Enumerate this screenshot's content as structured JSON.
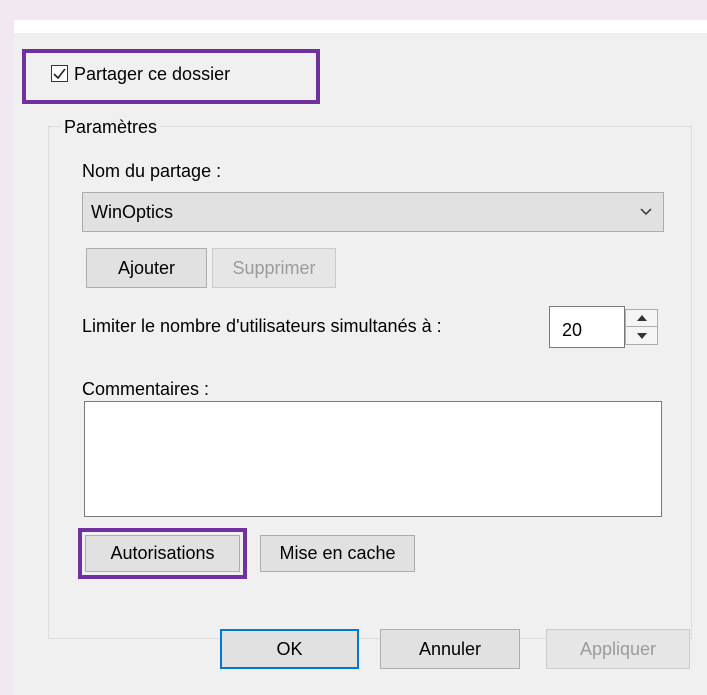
{
  "share": {
    "checkbox_label": "Partager ce dossier",
    "checked": true
  },
  "params": {
    "legend": "Paramètres",
    "share_name_label": "Nom du partage :",
    "share_name_value": "WinOptics",
    "add_button": "Ajouter",
    "remove_button": "Supprimer",
    "limit_label": "Limiter le nombre d'utilisateurs simultanés à :",
    "limit_value": "20",
    "comments_label": "Commentaires :",
    "comments_value": "",
    "permissions_button": "Autorisations",
    "caching_button": "Mise en cache"
  },
  "footer": {
    "ok_button": "OK",
    "cancel_button": "Annuler",
    "apply_button": "Appliquer"
  },
  "colors": {
    "highlight": "#7030a0",
    "default_button_border": "#0078d7",
    "dialog_background": "#f0f0f0"
  },
  "icons": {
    "checkbox": "checkmark-icon",
    "combo": "chevron-down-icon",
    "spin_up": "triangle-up-icon",
    "spin_down": "triangle-down-icon"
  }
}
